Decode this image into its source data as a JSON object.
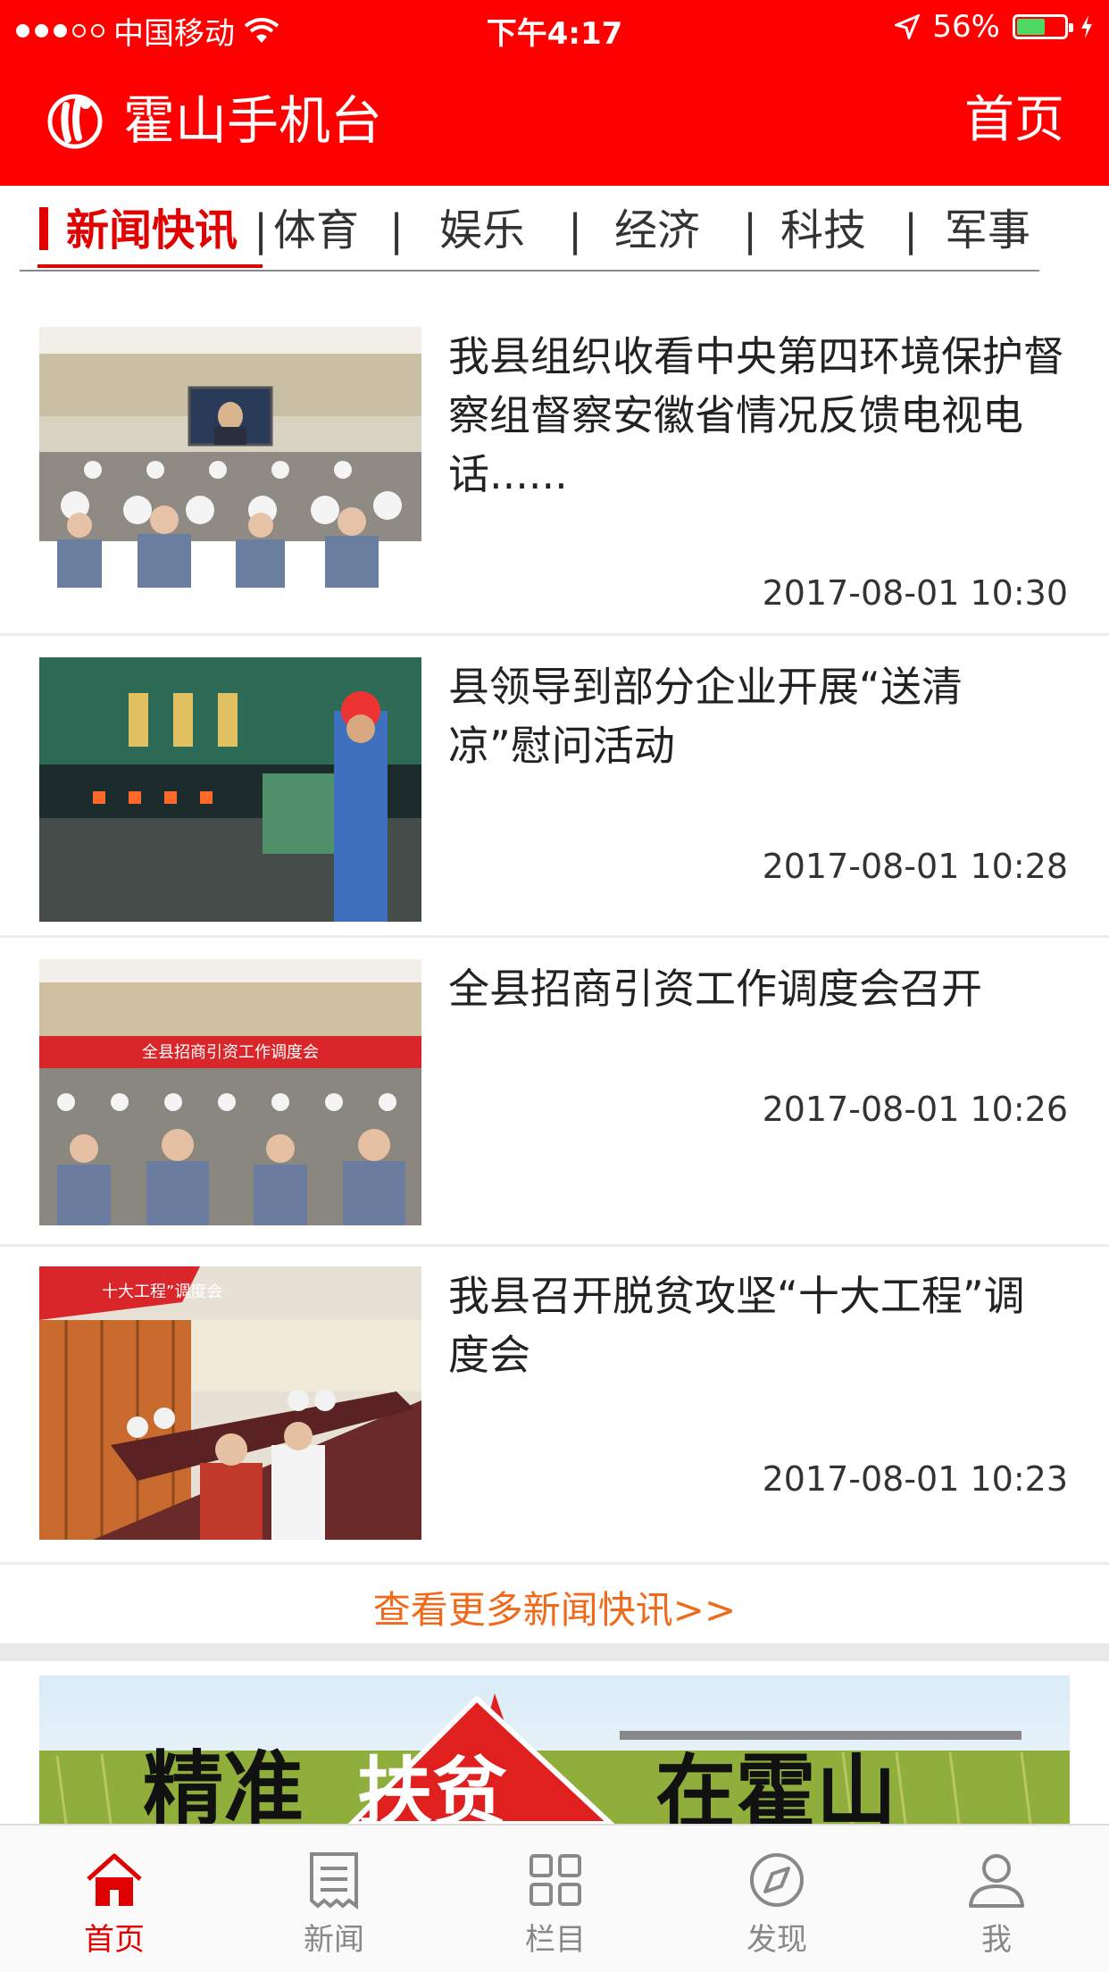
{
  "status_bar": {
    "carrier": "中国移动",
    "time": "下午4:17",
    "battery": "56%",
    "battery_level": 0.56
  },
  "header": {
    "title": "霍山手机台",
    "home_link": "首页"
  },
  "tabs": [
    "新闻快讯",
    "体育",
    "娱乐",
    "经济",
    "科技",
    "军事"
  ],
  "tab_separator": "|",
  "news": [
    {
      "title": "我县组织收看中央第四环境保护督察组督察安徽省情况反馈电视电话......",
      "time": "2017-08-01 10:30"
    },
    {
      "title": "县领导到部分企业开展“送清凉”慰问活动",
      "time": "2017-08-01 10:28"
    },
    {
      "title": "全县招商引资工作调度会召开",
      "time": "2017-08-01 10:26"
    },
    {
      "title": "我县召开脱贫攻坚“十大工程”调度会",
      "time": "2017-08-01 10:23"
    }
  ],
  "thumb_text": {
    "meeting_banner": "全县招商引资工作调度会",
    "project_banner": "十大工程”调度会"
  },
  "more_link": "查看更多新闻快讯>>",
  "banner_text": {
    "left": "精准",
    "center": "扶贫",
    "right": "在霍山"
  },
  "colors": {
    "brand": "#fe0000",
    "accent": "#e10000",
    "more_link": "#f06a1c"
  },
  "bottom_nav": [
    {
      "label": "首页",
      "icon": "home-icon",
      "active": true
    },
    {
      "label": "新闻",
      "icon": "news-icon",
      "active": false
    },
    {
      "label": "栏目",
      "icon": "grid-icon",
      "active": false
    },
    {
      "label": "发现",
      "icon": "compass-icon",
      "active": false
    },
    {
      "label": "我",
      "icon": "user-icon",
      "active": false
    }
  ]
}
